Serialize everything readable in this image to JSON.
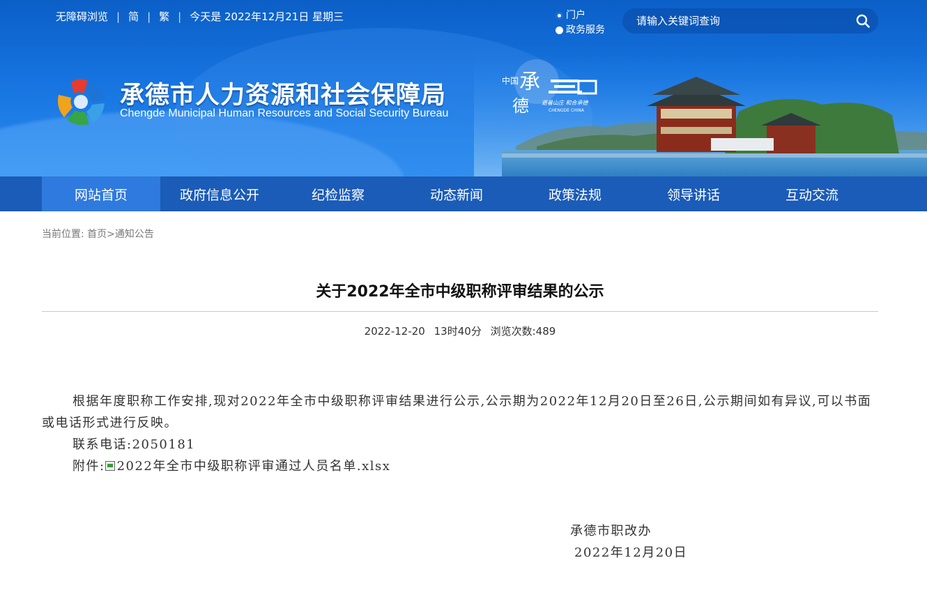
{
  "topbar": {
    "accessibility": "无障碍浏览",
    "simplified": "简",
    "traditional": "繁",
    "today": "今天是 2022年12月21日 星期三"
  },
  "search": {
    "scopes": [
      "门户",
      "政务服务"
    ],
    "selected_scope": "门户",
    "placeholder": "请输入关键词查询"
  },
  "header": {
    "title": "承德市人力资源和社会保障局",
    "subtitle": "Chengde Municipal Human Resources and Social Security Bureau",
    "brand_chars": [
      "中国",
      "承",
      "德"
    ],
    "brand_slogan": "避暑山庄 和合承德",
    "brand_en": "CHENGDE CHINA"
  },
  "nav": {
    "items": [
      "网站首页",
      "政府信息公开",
      "纪检监察",
      "动态新闻",
      "政策法规",
      "领导讲话",
      "互动交流"
    ],
    "active": "网站首页"
  },
  "breadcrumb": {
    "prefix": "当前位置:",
    "home": "首页",
    "sep": ">",
    "current": "通知公告"
  },
  "article": {
    "title": "关于2022年全市中级职称评审结果的公示",
    "date": "2022-12-20",
    "time": "13时40分",
    "views_label": "浏览次数:",
    "views": "489",
    "paragraph": "根据年度职称工作安排,现对2022年全市中级职称评审结果进行公示,公示期为2022年12月20日至26日,公示期间如有异议,可以书面或电话形式进行反映。",
    "contact": "联系电话:2050181",
    "attachment_label": "附件:",
    "attachment_name": "2022年全市中级职称评审通过人员名单.xlsx",
    "signature_org": "承德市职改办",
    "signature_date": "2022年12月20日"
  },
  "colors": {
    "banner_top": "#0b5fc7",
    "nav_bg": "#1b5cb8",
    "nav_active": "#2f7ade"
  }
}
